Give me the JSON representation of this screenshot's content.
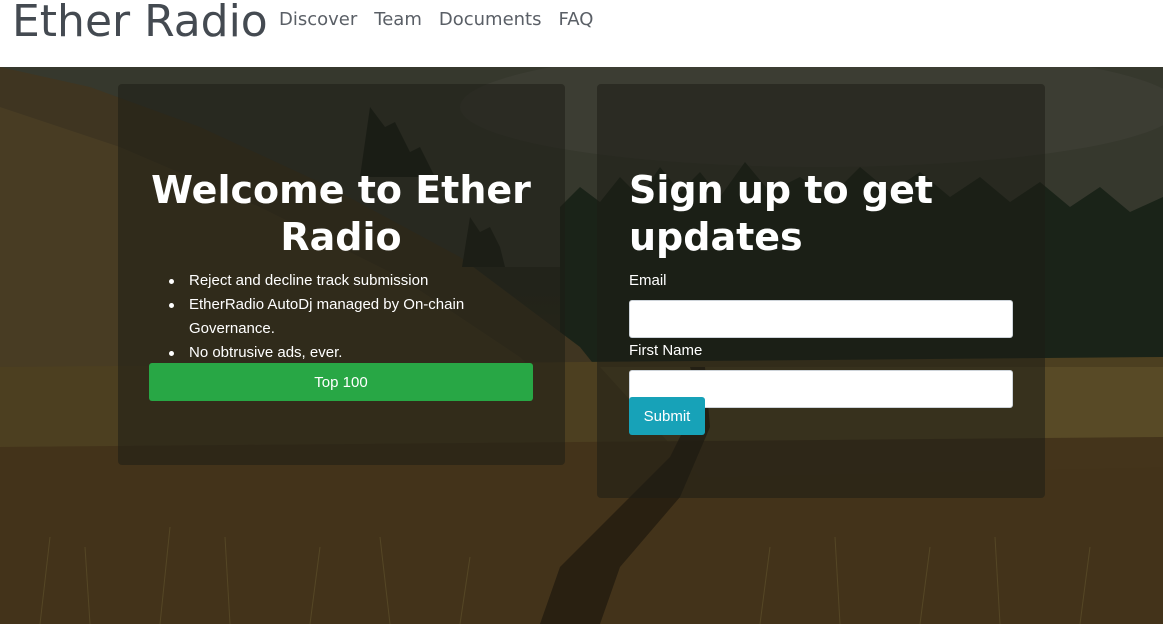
{
  "navbar": {
    "brand": "Ether Radio",
    "links": [
      "Discover",
      "Team",
      "Documents",
      "FAQ"
    ]
  },
  "welcome": {
    "title": "Welcome to Ether Radio",
    "features": [
      "Reject and decline track submission",
      "EtherRadio AutoDj managed by On-chain Governance.",
      "No obtrusive ads, ever."
    ],
    "button_label": "Top 100"
  },
  "signup": {
    "title": "Sign up to get updates",
    "email_label": "Email",
    "email_value": "",
    "first_name_label": "First Name",
    "first_name_value": "",
    "submit_label": "Submit"
  },
  "colors": {
    "primary_button": "#28a745",
    "submit_button": "#17a2b8"
  }
}
